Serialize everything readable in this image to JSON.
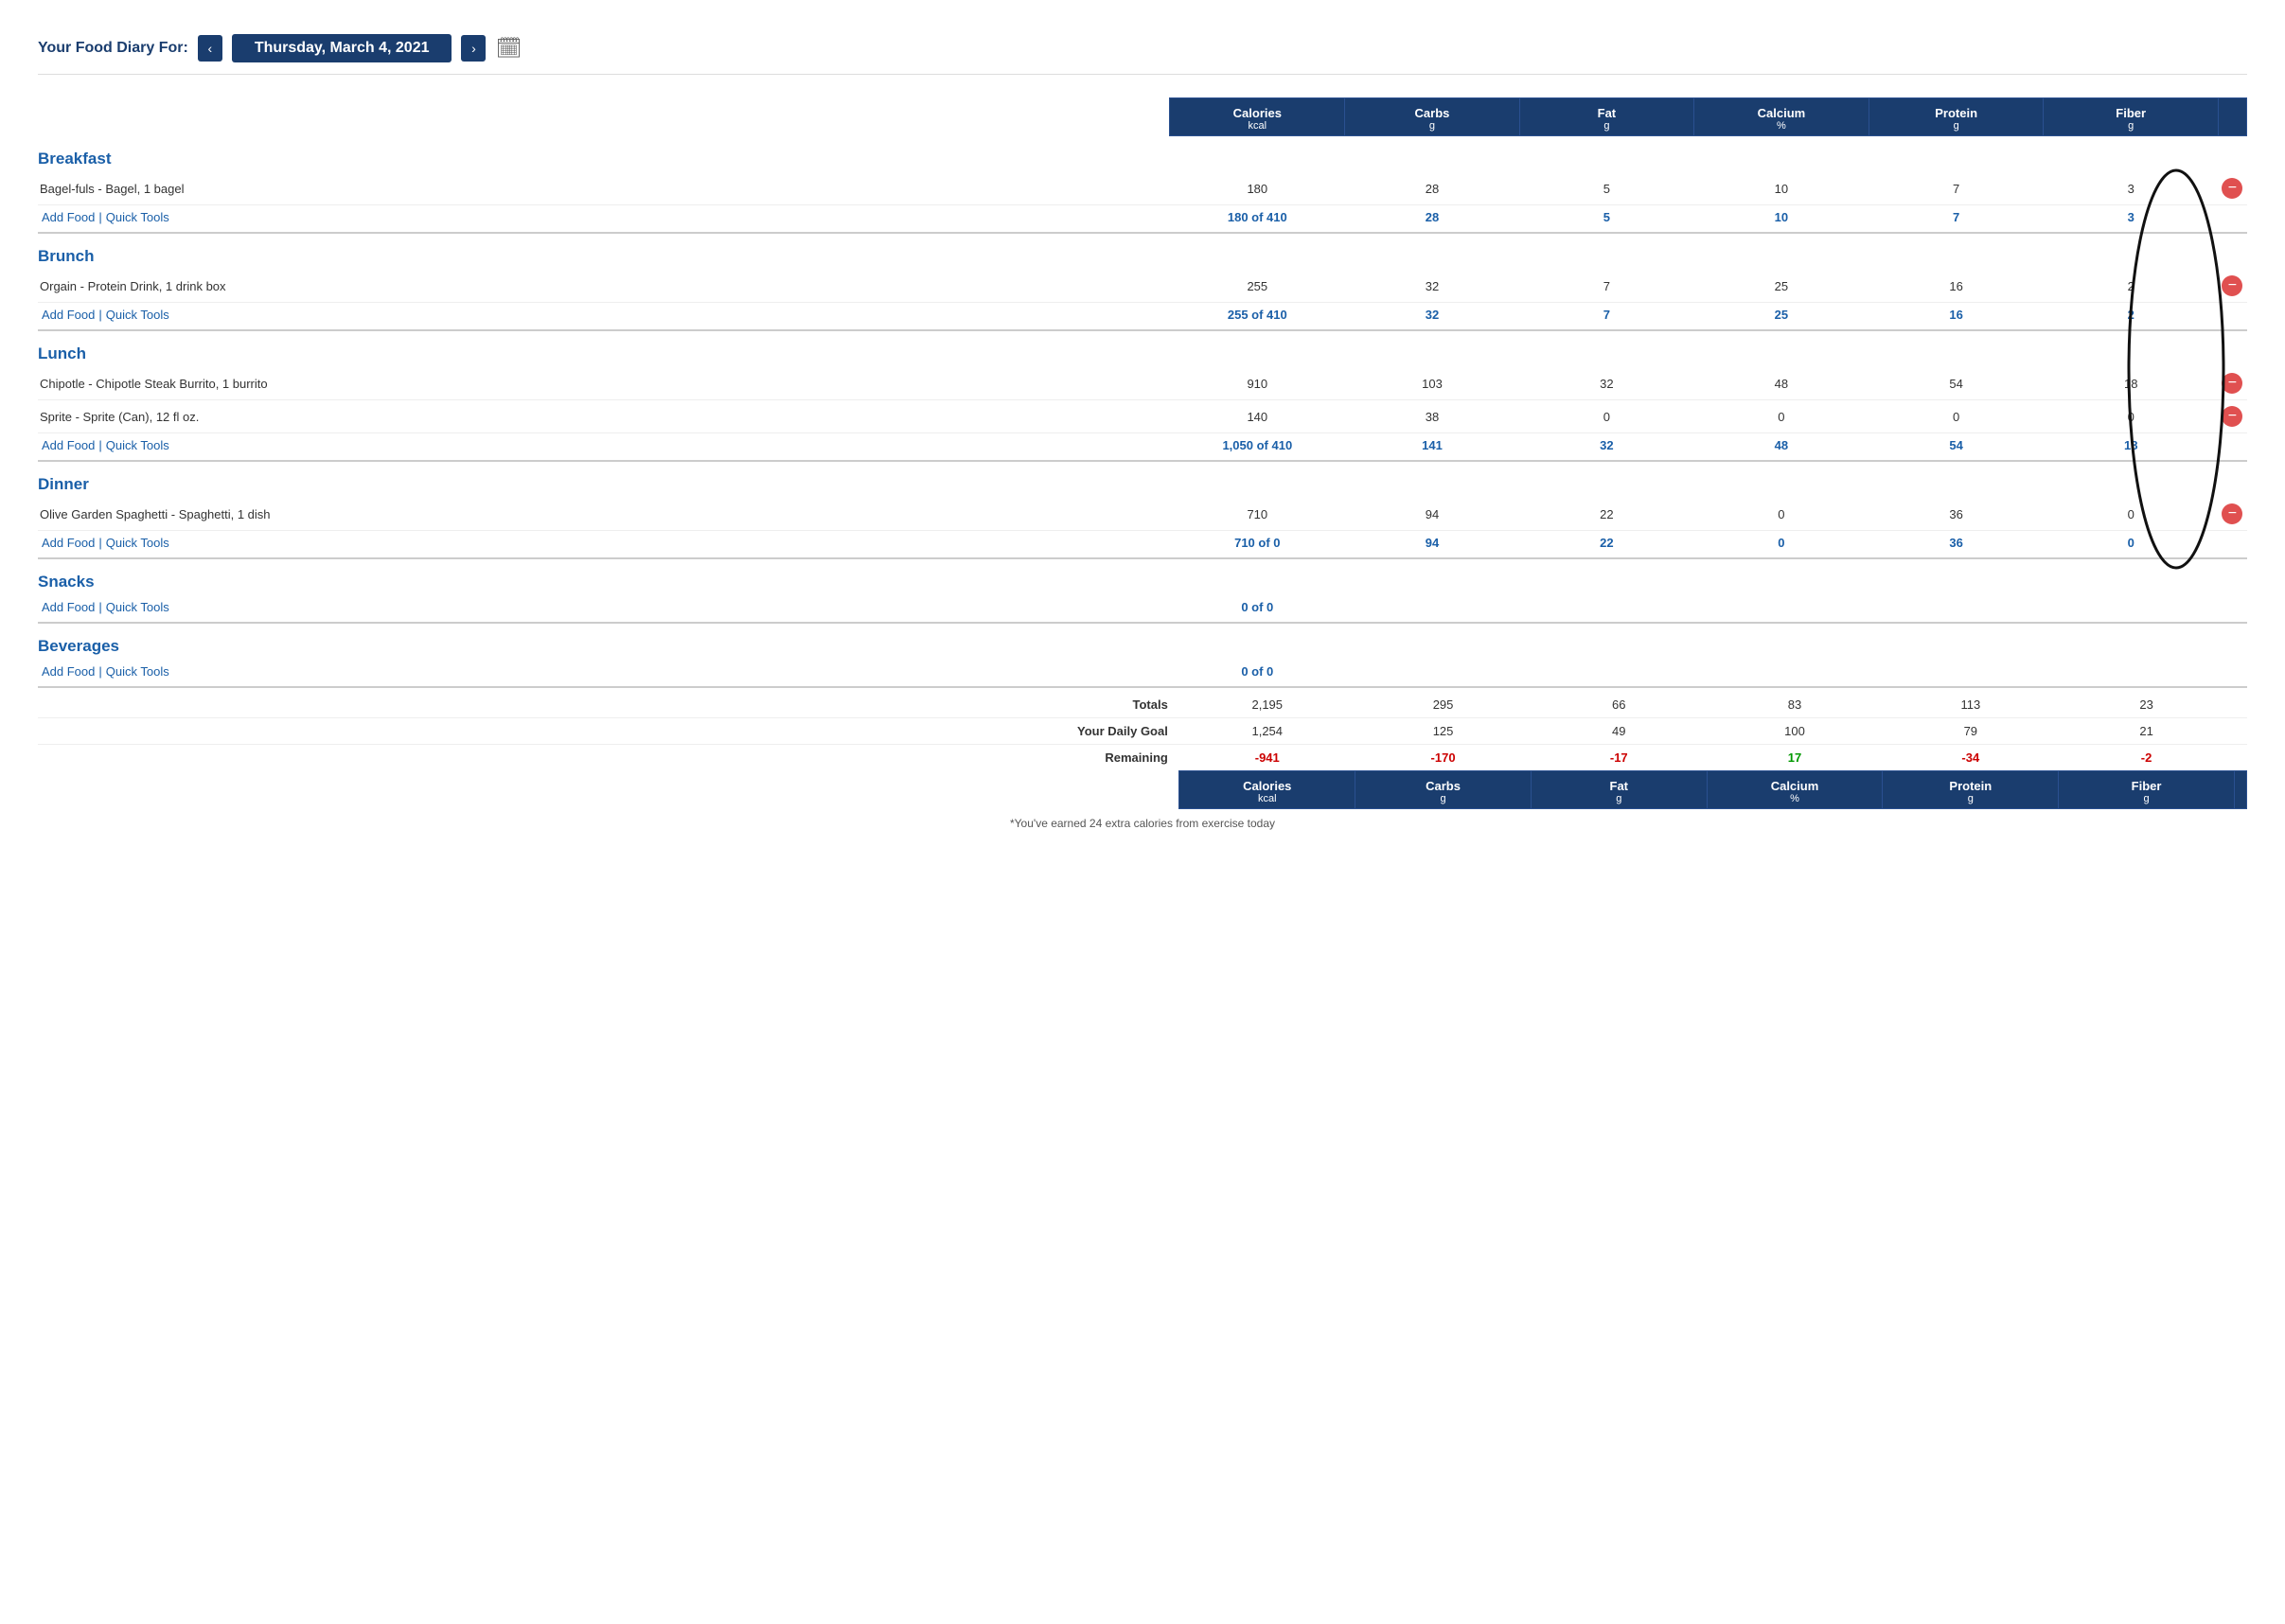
{
  "header": {
    "label": "Your Food Diary For:",
    "date": "Thursday, March 4, 2021",
    "prev_label": "‹",
    "next_label": "›",
    "calendar_symbol": "📅"
  },
  "columns": {
    "headers": [
      {
        "label": "Calories",
        "sub": "kcal"
      },
      {
        "label": "Carbs",
        "sub": "g"
      },
      {
        "label": "Fat",
        "sub": "g"
      },
      {
        "label": "Calcium",
        "sub": "%"
      },
      {
        "label": "Protein",
        "sub": "g"
      },
      {
        "label": "Fiber",
        "sub": "g"
      }
    ]
  },
  "sections": [
    {
      "id": "breakfast",
      "name": "Breakfast",
      "items": [
        {
          "name": "Bagel-fuls - Bagel, 1 bagel",
          "calories": 180,
          "carbs": 28,
          "fat": 5,
          "calcium": 10,
          "protein": 7,
          "fiber": 3,
          "removable": true
        }
      ],
      "summary": {
        "calories": "180 of 410",
        "carbs": "28",
        "fat": "5",
        "calcium": "10",
        "protein": "7",
        "fiber": "3"
      },
      "add_food": "Add Food",
      "quick_tools": "Quick Tools"
    },
    {
      "id": "brunch",
      "name": "Brunch",
      "items": [
        {
          "name": "Orgain - Protein Drink, 1 drink box",
          "calories": 255,
          "carbs": 32,
          "fat": 7,
          "calcium": 25,
          "protein": 16,
          "fiber": 2,
          "removable": true
        }
      ],
      "summary": {
        "calories": "255 of 410",
        "carbs": "32",
        "fat": "7",
        "calcium": "25",
        "protein": "16",
        "fiber": "2"
      },
      "add_food": "Add Food",
      "quick_tools": "Quick Tools"
    },
    {
      "id": "lunch",
      "name": "Lunch",
      "items": [
        {
          "name": "Chipotle - Chipotle Steak Burrito, 1 burrito",
          "calories": 910,
          "carbs": 103,
          "fat": 32,
          "calcium": 48,
          "protein": 54,
          "fiber": 18,
          "removable": true
        },
        {
          "name": "Sprite - Sprite (Can), 12 fl oz.",
          "calories": 140,
          "carbs": 38,
          "fat": 0,
          "calcium": 0,
          "protein": 0,
          "fiber": 0,
          "removable": true
        }
      ],
      "summary": {
        "calories": "1,050 of 410",
        "carbs": "141",
        "fat": "32",
        "calcium": "48",
        "protein": "54",
        "fiber": "18"
      },
      "add_food": "Add Food",
      "quick_tools": "Quick Tools"
    },
    {
      "id": "dinner",
      "name": "Dinner",
      "items": [
        {
          "name": "Olive Garden Spaghetti - Spaghetti, 1 dish",
          "calories": 710,
          "carbs": 94,
          "fat": 22,
          "calcium": 0,
          "protein": 36,
          "fiber": 0,
          "removable": true
        }
      ],
      "summary": {
        "calories": "710 of 0",
        "carbs": "94",
        "fat": "22",
        "calcium": "0",
        "protein": "36",
        "fiber": "0"
      },
      "add_food": "Add Food",
      "quick_tools": "Quick Tools"
    },
    {
      "id": "snacks",
      "name": "Snacks",
      "items": [],
      "summary": {
        "calories": "0 of 0",
        "carbs": "",
        "fat": "",
        "calcium": "",
        "protein": "",
        "fiber": ""
      },
      "add_food": "Add Food",
      "quick_tools": "Quick Tools"
    },
    {
      "id": "beverages",
      "name": "Beverages",
      "items": [],
      "summary": {
        "calories": "0 of 0",
        "carbs": "",
        "fat": "",
        "calcium": "",
        "protein": "",
        "fiber": ""
      },
      "add_food": "Add Food",
      "quick_tools": "Quick Tools"
    }
  ],
  "totals": {
    "label": "Totals",
    "calories": "2,195",
    "carbs": "295",
    "fat": "66",
    "calcium": "83",
    "protein": "113",
    "fiber": "23"
  },
  "daily_goal": {
    "label": "Your Daily Goal",
    "calories": "1,254",
    "carbs": "125",
    "fat": "49",
    "calcium": "100",
    "protein": "79",
    "fiber": "21"
  },
  "remaining": {
    "label": "Remaining",
    "calories": "-941",
    "carbs": "-170",
    "fat": "-17",
    "calcium": "17",
    "protein": "-34",
    "fiber": "-2"
  },
  "exercise_note": "*You've earned 24 extra calories from exercise today"
}
